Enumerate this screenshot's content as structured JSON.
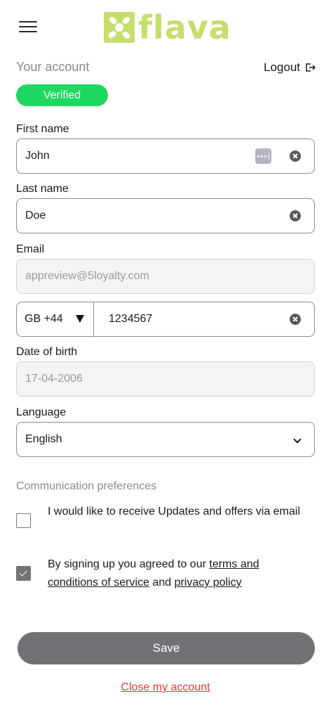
{
  "header": {
    "logo_text": "flava",
    "brand_color": "#c5de6d"
  },
  "account": {
    "title": "Your account",
    "logout_label": "Logout",
    "status_badge": "Verified",
    "badge_color": "#1ed760"
  },
  "form": {
    "first_name": {
      "label": "First name",
      "value": "John"
    },
    "last_name": {
      "label": "Last name",
      "value": "Doe"
    },
    "email": {
      "label": "Email",
      "value": "appreview@5loyalty.com"
    },
    "phone": {
      "country_code": "GB +44",
      "number": "1234567"
    },
    "dob": {
      "label": "Date of birth",
      "value": "17-04-2006"
    },
    "language": {
      "label": "Language",
      "value": "English"
    }
  },
  "preferences": {
    "title": "Communication preferences",
    "updates": {
      "text": "I would like to receive Updates and offers via email",
      "checked": false
    },
    "terms": {
      "text_before": "By signing up you agreed to our ",
      "terms_link": "terms and conditions of service",
      "text_middle": " and ",
      "privacy_link": "privacy policy",
      "checked": true
    }
  },
  "actions": {
    "save_label": "Save",
    "close_account_label": "Close my account",
    "danger_color": "#e53935"
  }
}
